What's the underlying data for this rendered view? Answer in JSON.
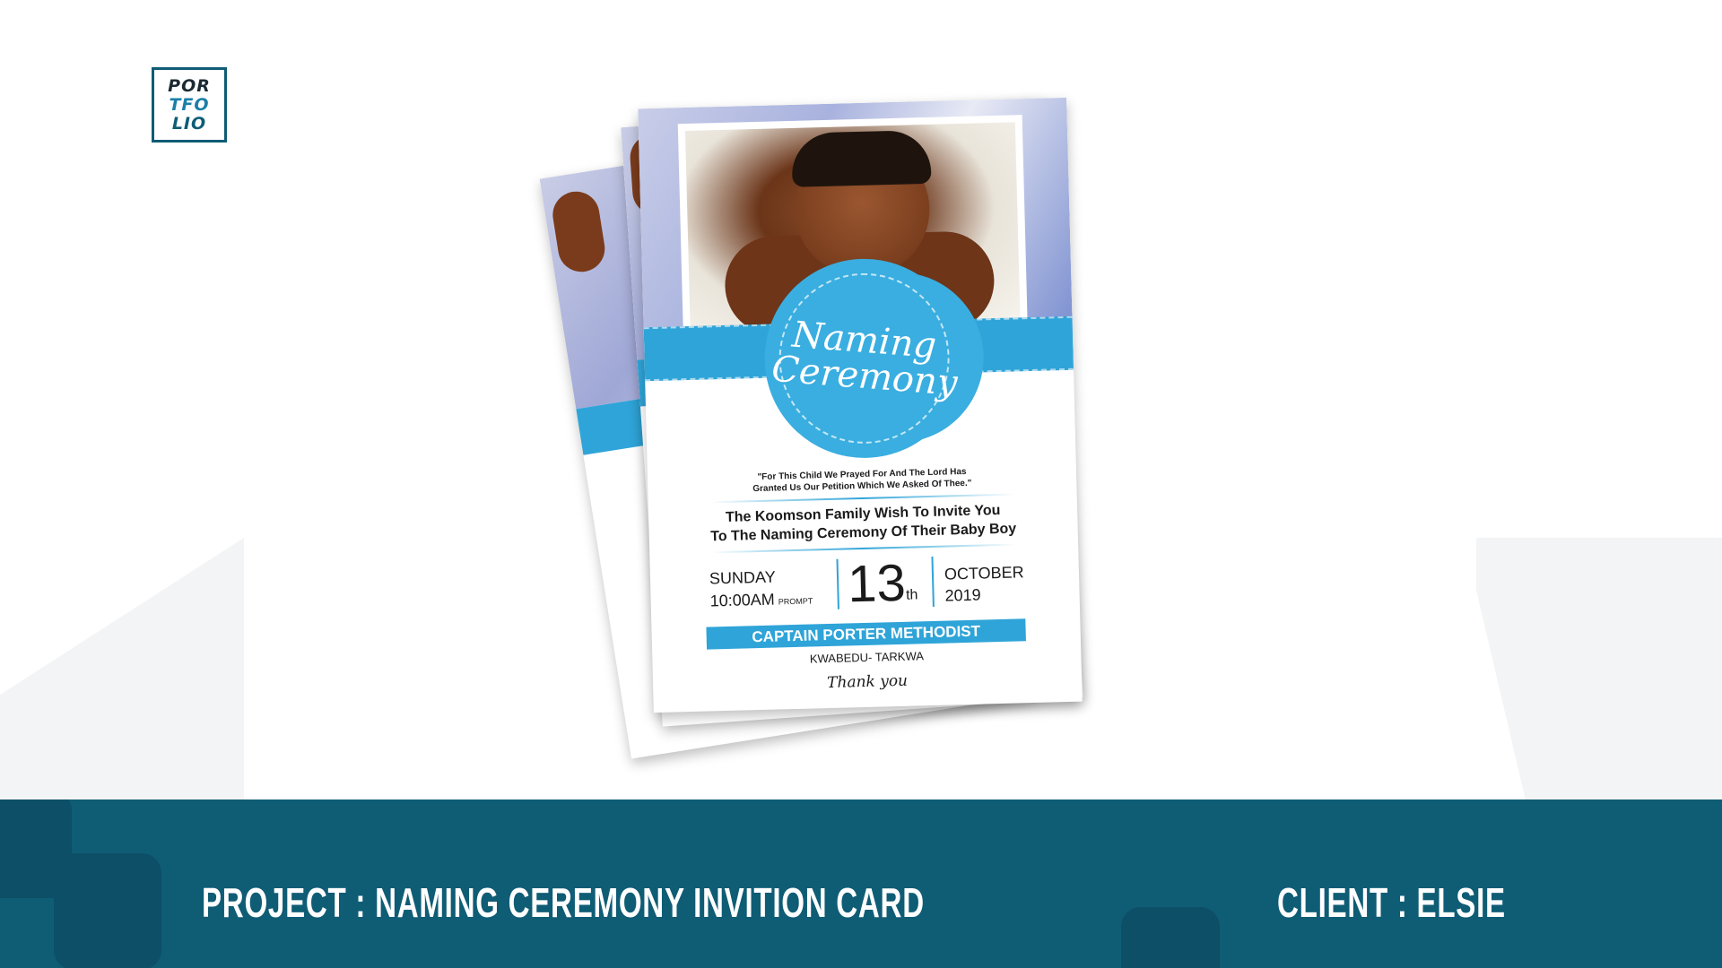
{
  "logo": {
    "line1": "POR",
    "line2": "TFO",
    "line3": "LIO"
  },
  "card": {
    "badge_line1": "Naming",
    "badge_line2": "Ceremony",
    "quote_line1": "\"For This Child We Prayed For And The Lord Has",
    "quote_line2": "Granted Us Our Petition Which We Asked Of Thee.\"",
    "invite_line1": "The Koomson Family Wish To Invite You",
    "invite_line2": "To The Naming Ceremony Of Their Baby Boy",
    "weekday": "SUNDAY",
    "time": "10:00AM",
    "prompt": "PROMPT",
    "day": "13",
    "day_suffix": "th",
    "month": "OCTOBER",
    "year": "2019",
    "venue": "CAPTAIN PORTER METHODIST",
    "town": "KWABEDU- TARKWA",
    "thanks": "Thank you"
  },
  "footer": {
    "project": "PROJECT : NAMING CEREMONY INVITION CARD",
    "client": "CLIENT : ELSIE"
  },
  "colors": {
    "brand": "#0f5c75",
    "accent": "#2fa4d8"
  }
}
